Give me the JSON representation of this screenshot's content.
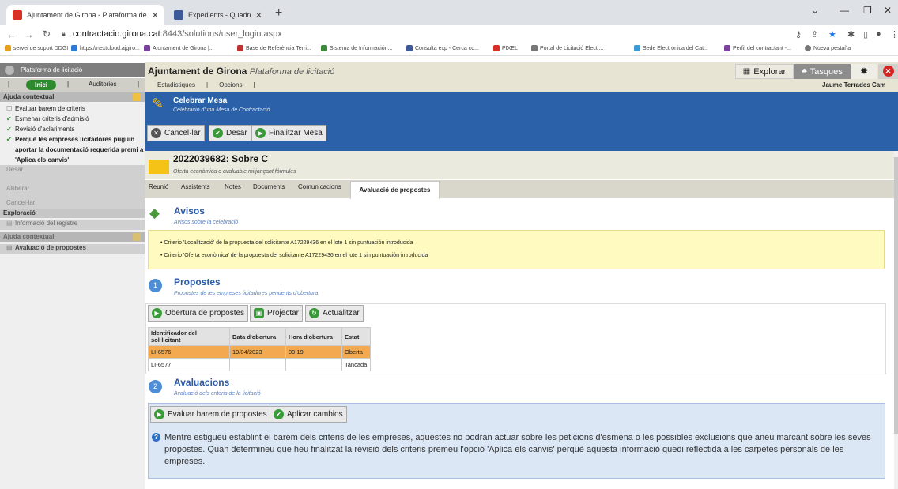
{
  "browser": {
    "tabs": [
      {
        "title": "Ajuntament de Girona - Plataforma de",
        "fav": "#d93025"
      },
      {
        "title": "Expedients - Quadre de comandament",
        "fav": "#3c5a99"
      }
    ],
    "url_host": "contractacio.girona.cat",
    "url_path": ":8443/solutions/user_login.aspx",
    "bookmarks": [
      "servei de suport DDGI",
      "https://nextcloud.ajgiro...",
      "Ajuntament de Girona |...",
      "Base de Referència Terri...",
      "Sistema de Información...",
      "Consulta exp - Cerca co...",
      "PIXEL",
      "Portal de Licitació Electr...",
      "Sede Electrónica del Cat...",
      "Perfil del contractant -...",
      "Nueva pestaña"
    ]
  },
  "app": {
    "sidebar_title": "Plataforma de licitació",
    "title": "Ajuntament de Girona",
    "title_italic": "Plataforma de licitació",
    "nav": [
      "Estadístiques",
      "|",
      "Opcions",
      "|"
    ],
    "left_tabs": [
      "Inici",
      "Auditories"
    ],
    "explorar": "Explorar",
    "tasques": "Tasques",
    "user": "Jaume Terrades Cam"
  },
  "sidebar": {
    "sec1": "Ajuda contextual",
    "items1": [
      {
        "label": "Evaluar barem de criteris",
        "check": false
      },
      {
        "label": "Esmenar criteris d'admisió",
        "check": true
      },
      {
        "label": "Revisió d'aclariments",
        "check": true
      },
      {
        "label": "Perquè les empreses licitadores puguin",
        "check": true
      },
      {
        "label": "aportar la documentació requerida premi a",
        "check": null
      },
      {
        "label": "'Aplica els canvis'",
        "check": null
      }
    ],
    "items_gray": [
      "Desar",
      "Alliberar",
      "Cancel·lar"
    ],
    "sec2": "Exploració",
    "explore_item": "Informació del registre",
    "sec3": "Ajuda contextual",
    "help_item": "Avaluació de propostes"
  },
  "blue": {
    "title": "Celebrar Mesa",
    "subtitle": "Celebració d'una Mesa de Contractació",
    "buttons": [
      "Cancel·lar",
      "Desar",
      "Finalitzar Mesa"
    ]
  },
  "record": {
    "id": "2022039682: Sobre C",
    "subtitle": "Oferta econòmica o avaluable mitjançant fórmules"
  },
  "content_tabs": [
    "Reunió",
    "Assistents",
    "Notes",
    "Documents",
    "Comunicacions",
    "Avaluació de propostes"
  ],
  "avisos": {
    "title": "Avisos",
    "subtitle": "Avisos sobre la celebració",
    "lines": [
      "Criterio 'Localització' de la propuesta del solicitante A17229436 en el lote 1 sin puntuación introducida",
      "Criterio 'Oferta econòmica' de la propuesta del solicitante A17229436 en el lote 1 sin puntuación introducida"
    ]
  },
  "propostes": {
    "num": "1",
    "title": "Propostes",
    "subtitle": "Propostes de les empreses licitadores pendents d'obertura",
    "buttons": [
      "Obertura de propostes",
      "Projectar",
      "Actualitzar"
    ],
    "columns": [
      "Identificador del sol·licitant",
      "Data d'obertura",
      "Hora d'obertura",
      "Estat"
    ],
    "rows": [
      [
        "LI-6576",
        "19/04/2023",
        "09:19",
        "Oberta"
      ],
      [
        "LI-6577",
        "",
        "",
        "Tancada"
      ]
    ]
  },
  "avaluacions": {
    "num": "2",
    "title": "Avaluacions",
    "subtitle": "Avaluació dels criteris de la licitació",
    "buttons": [
      "Evaluar barem de propostes",
      "Aplicar cambios"
    ],
    "info": "Mentre estigueu establint el barem dels criteris de les empreses, aquestes no podran actuar sobre les peticions d'esmena o les possibles exclusions que aneu marcant sobre les seves propostes. Quan determineu que heu finalitzat la revisió dels criteris premeu l'opció 'Aplica els canvis' perquè aquesta informació quedi reflectida a les carpetes personals de les empreses."
  }
}
